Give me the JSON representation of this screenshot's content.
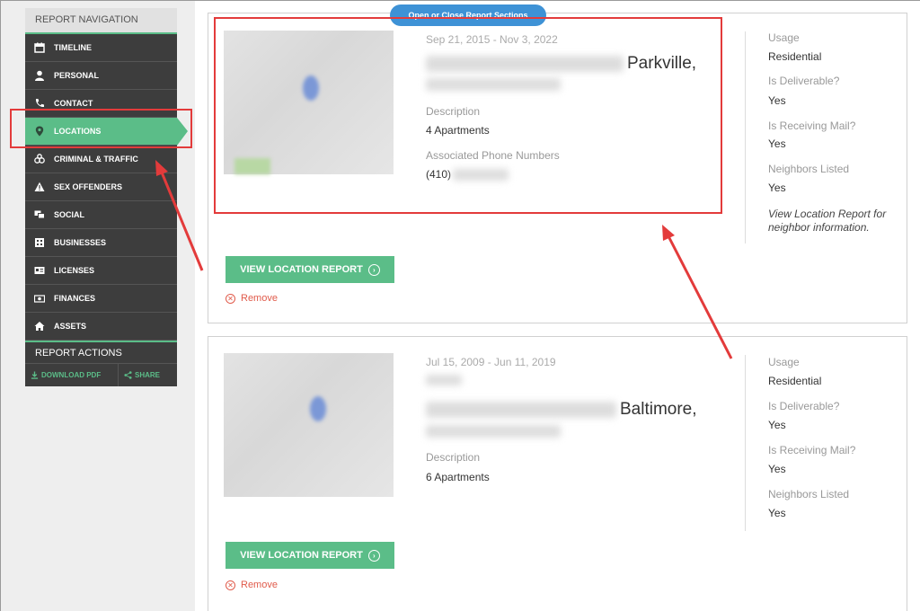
{
  "nav": {
    "header": "REPORT NAVIGATION",
    "items": [
      {
        "label": "TIMELINE",
        "icon": "calendar-icon"
      },
      {
        "label": "PERSONAL",
        "icon": "person-icon"
      },
      {
        "label": "CONTACT",
        "icon": "phone-icon"
      },
      {
        "label": "LOCATIONS",
        "icon": "map-pin-icon"
      },
      {
        "label": "CRIMINAL & TRAFFIC",
        "icon": "handcuffs-icon"
      },
      {
        "label": "SEX OFFENDERS",
        "icon": "warning-icon"
      },
      {
        "label": "SOCIAL",
        "icon": "social-icon"
      },
      {
        "label": "BUSINESSES",
        "icon": "building-icon"
      },
      {
        "label": "LICENSES",
        "icon": "id-card-icon"
      },
      {
        "label": "FINANCES",
        "icon": "money-icon"
      },
      {
        "label": "ASSETS",
        "icon": "home-icon"
      }
    ],
    "active": "LOCATIONS"
  },
  "actions": {
    "header": "REPORT ACTIONS",
    "download": "DOWNLOAD PDF",
    "share": "SHARE"
  },
  "toggle_label": "Open or Close Report Sections",
  "locations": [
    {
      "dates": "Sep 21, 2015 - Nov 3, 2022",
      "city": "Parkville,",
      "description_label": "Description",
      "description": "4 Apartments",
      "phones_label": "Associated Phone Numbers",
      "phone_prefix": "(410)",
      "usage_label": "Usage",
      "usage": "Residential",
      "deliverable_label": "Is Deliverable?",
      "deliverable": "Yes",
      "mail_label": "Is Receiving Mail?",
      "mail": "Yes",
      "neighbors_label": "Neighbors Listed",
      "neighbors": "Yes",
      "note": "View Location Report for neighbor information.",
      "view_button": "VIEW LOCATION REPORT",
      "remove": "Remove"
    },
    {
      "dates": "Jul 15, 2009 - Jun 11, 2019",
      "city": "Baltimore,",
      "description_label": "Description",
      "description": "6 Apartments",
      "usage_label": "Usage",
      "usage": "Residential",
      "deliverable_label": "Is Deliverable?",
      "deliverable": "Yes",
      "mail_label": "Is Receiving Mail?",
      "mail": "Yes",
      "neighbors_label": "Neighbors Listed",
      "neighbors": "Yes",
      "view_button": "VIEW LOCATION REPORT",
      "remove": "Remove"
    }
  ],
  "colors": {
    "accent": "#5bbd88",
    "sidebar": "#3d3d3d",
    "highlight": "#e33b3b",
    "toggle": "#3e92d6",
    "remove": "#e05a4a"
  }
}
